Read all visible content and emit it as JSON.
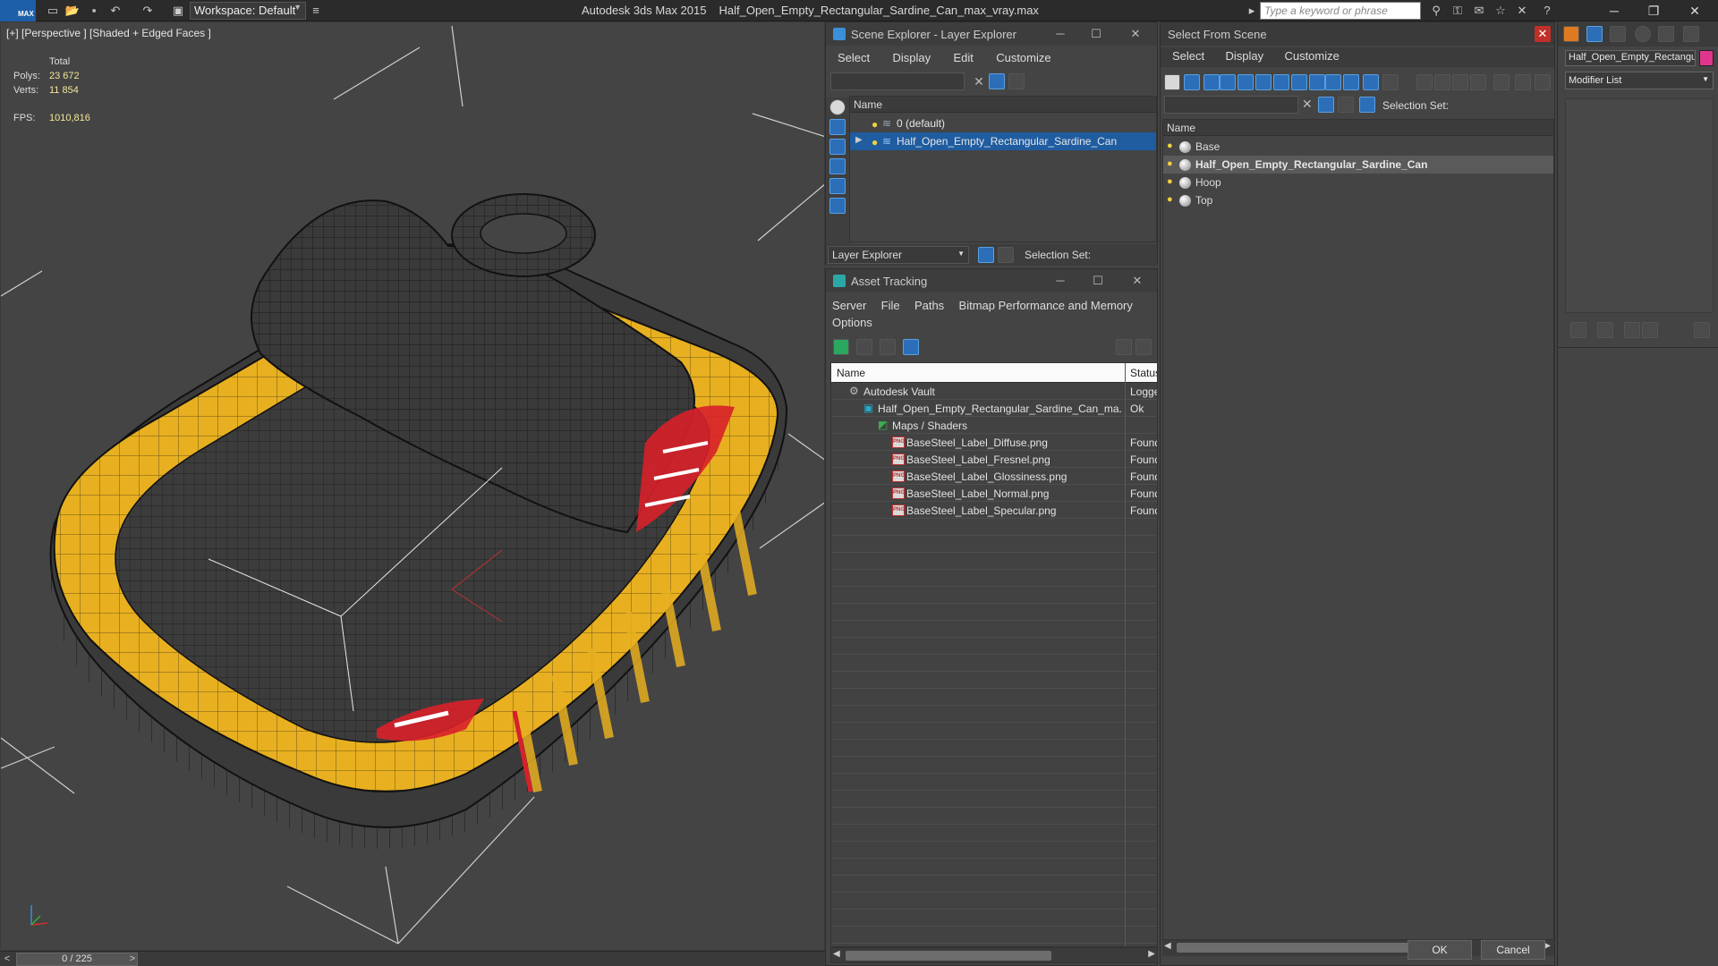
{
  "app": {
    "logo": "MAX",
    "workspace_label": "Workspace: Default",
    "title_app": "Autodesk 3ds Max  2015",
    "title_file": "Half_Open_Empty_Rectangular_Sardine_Can_max_vray.max",
    "search_placeholder": "Type a keyword or phrase"
  },
  "viewport": {
    "label": "[+] [Perspective ] [Shaded + Edged Faces ]",
    "stats": {
      "total_label": "Total",
      "polys_label": "Polys:",
      "polys_value": "23 672",
      "verts_label": "Verts:",
      "verts_value": "11 854",
      "fps_label": "FPS:",
      "fps_value": "1010,816"
    }
  },
  "timeline": {
    "frame_label": "0 / 225",
    "prev": "<",
    "next": ">"
  },
  "scene_explorer": {
    "title": "Scene Explorer - Layer Explorer",
    "menu": [
      "Select",
      "Display",
      "Edit",
      "Customize"
    ],
    "column_name": "Name",
    "rows": [
      {
        "label": "0 (default)",
        "selected": false
      },
      {
        "label": "Half_Open_Empty_Rectangular_Sardine_Can",
        "selected": true
      }
    ],
    "bottom_combo": "Layer Explorer",
    "selection_set_label": "Selection Set:"
  },
  "asset_tracking": {
    "title": "Asset Tracking",
    "menu_row1": [
      "Server",
      "File",
      "Paths",
      "Bitmap Performance and Memory"
    ],
    "menu_row2": [
      "Options"
    ],
    "col_name": "Name",
    "col_status": "Status",
    "rows": [
      {
        "name": "Autodesk Vault",
        "status": "Logged",
        "indent": 0,
        "icon": "vault"
      },
      {
        "name": "Half_Open_Empty_Rectangular_Sardine_Can_ma...",
        "status": "Ok",
        "indent": 1,
        "icon": "max-file"
      },
      {
        "name": "Maps / Shaders",
        "status": "",
        "indent": 2,
        "icon": "maps"
      },
      {
        "name": "BaseSteel_Label_Diffuse.png",
        "status": "Found",
        "indent": 3,
        "icon": "png"
      },
      {
        "name": "BaseSteel_Label_Fresnel.png",
        "status": "Found",
        "indent": 3,
        "icon": "png"
      },
      {
        "name": "BaseSteel_Label_Glossiness.png",
        "status": "Found",
        "indent": 3,
        "icon": "png"
      },
      {
        "name": "BaseSteel_Label_Normal.png",
        "status": "Found",
        "indent": 3,
        "icon": "png"
      },
      {
        "name": "BaseSteel_Label_Specular.png",
        "status": "Found",
        "indent": 3,
        "icon": "png"
      }
    ]
  },
  "select_from_scene": {
    "title": "Select From Scene",
    "menu": [
      "Select",
      "Display",
      "Customize"
    ],
    "selection_set_label": "Selection Set:",
    "column_name": "Name",
    "rows": [
      {
        "label": "Base",
        "selected": false
      },
      {
        "label": "Half_Open_Empty_Rectangular_Sardine_Can",
        "selected": true
      },
      {
        "label": "Hoop",
        "selected": false
      },
      {
        "label": "Top",
        "selected": false
      }
    ],
    "ok_label": "OK",
    "cancel_label": "Cancel"
  },
  "command_panel": {
    "object_name": "Half_Open_Empty_Rectangul",
    "object_color": "#e0358c",
    "modifier_list": "Modifier List"
  },
  "colors": {
    "accent_blue": "#1f5ca0",
    "can_yellow": "#e8b020",
    "label_red": "#d8202a"
  }
}
